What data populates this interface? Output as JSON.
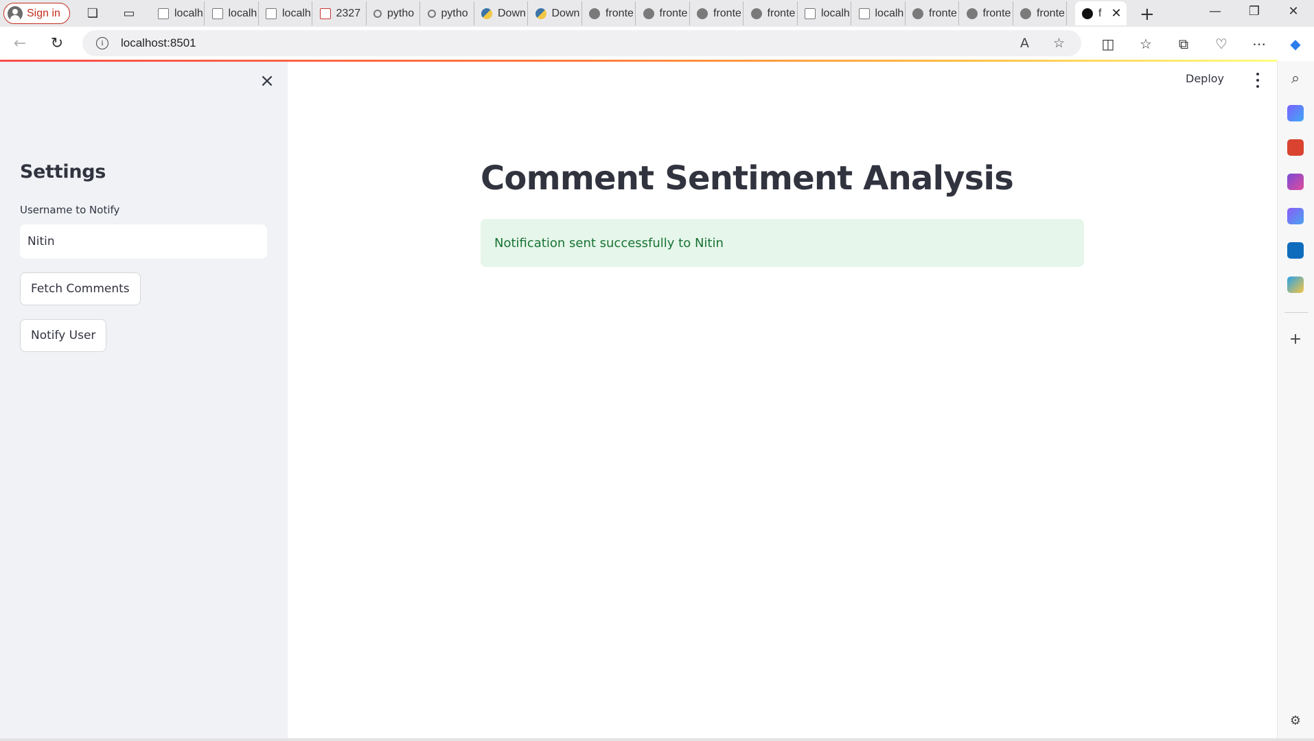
{
  "browser": {
    "signin_label": "Sign in",
    "tabs": [
      {
        "label": "localh",
        "icon": "doc-icon"
      },
      {
        "label": "localh",
        "icon": "doc-icon"
      },
      {
        "label": "localh",
        "icon": "doc-icon"
      },
      {
        "label": "2327",
        "icon": "pdf-icon"
      },
      {
        "label": "pytho",
        "icon": "search-icon"
      },
      {
        "label": "pytho",
        "icon": "search-icon"
      },
      {
        "label": "Down",
        "icon": "python-icon"
      },
      {
        "label": "Down",
        "icon": "python-icon"
      },
      {
        "label": "fronte",
        "icon": "streamlit-icon"
      },
      {
        "label": "fronte",
        "icon": "streamlit-icon"
      },
      {
        "label": "fronte",
        "icon": "streamlit-icon"
      },
      {
        "label": "fronte",
        "icon": "streamlit-icon"
      },
      {
        "label": "localh",
        "icon": "doc-icon"
      },
      {
        "label": "localh",
        "icon": "doc-icon"
      },
      {
        "label": "fronte",
        "icon": "streamlit-icon"
      },
      {
        "label": "fronte",
        "icon": "streamlit-icon"
      },
      {
        "label": "fronte",
        "icon": "streamlit-icon"
      }
    ],
    "active_tab_label": "f",
    "address": "localhost:8501"
  },
  "sidebar": {
    "title": "Settings",
    "username_label": "Username to Notify",
    "username_value": "Nitin",
    "fetch_button": "Fetch Comments",
    "notify_button": "Notify User"
  },
  "main": {
    "deploy_label": "Deploy",
    "title": "Comment Sentiment Analysis",
    "success_message": "Notification sent successfully to Nitin"
  },
  "colors": {
    "sidebar_bg": "#f0f2f6",
    "success_bg": "#e6f6ea",
    "success_text": "#177233",
    "text_primary": "#31333f"
  }
}
